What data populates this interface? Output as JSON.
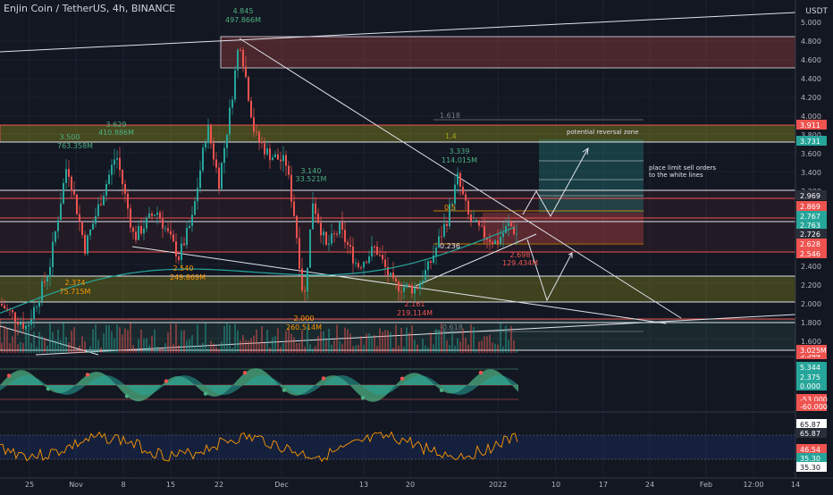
{
  "header": {
    "title": "Enjin Coin / TetherUS, 4h, BINANCE",
    "currency": "USDT"
  },
  "colors": {
    "background": "#131722",
    "text": "#b2b5be",
    "up": "#26a69a",
    "down": "#ef5350",
    "white_line": "#e0e3eb",
    "resistance_zone": "#ef5350",
    "support_zone": "#a5a41a",
    "rsi_line": "#ff9800",
    "rsi_band": "#2962ff",
    "wave_green": "#4caf80",
    "dot_red": "#ef5350",
    "dot_green": "#4caf80"
  },
  "price_axis": {
    "ticks": [
      "5.000",
      "4.800",
      "4.600",
      "4.400",
      "4.200",
      "4.000",
      "3.800",
      "3.600",
      "3.400",
      "3.200",
      "2.400",
      "2.200",
      "2.000",
      "1.800",
      "1.600"
    ],
    "tags": [
      {
        "value": "5.344",
        "color": "#ef5350"
      },
      {
        "value": "3.911",
        "color": "#ef5350"
      },
      {
        "value": "3.731",
        "color": "#26a69a"
      },
      {
        "value": "2.969",
        "color": "#2a2e39"
      },
      {
        "value": "2.869",
        "color": "#ef5350"
      },
      {
        "value": "2.767",
        "color": "#26a69a"
      },
      {
        "value": "2.763",
        "color": "#26a69a"
      },
      {
        "value": "2.726",
        "color": "#2a2e39"
      },
      {
        "value": "2.628",
        "color": "#ef5350"
      },
      {
        "value": "2.546",
        "color": "#ef5350"
      },
      {
        "value": "3.025M",
        "color": "#ef5350"
      }
    ],
    "range": [
      1.45,
      5.15
    ]
  },
  "osc_axis": {
    "tags": [
      {
        "value": "5.344",
        "color": "#26a69a"
      },
      {
        "value": "2.375",
        "color": "#26a69a"
      },
      {
        "value": "0.000",
        "color": "#26a69a"
      },
      {
        "value": "-53.000",
        "color": "#ef5350"
      },
      {
        "value": "-60.000",
        "color": "#ef5350"
      }
    ]
  },
  "rsi_axis": {
    "tags": [
      {
        "value": "65.87",
        "color": "#ffffff"
      },
      {
        "value": "65.87",
        "color": "#2a2e39"
      },
      {
        "value": "46.54",
        "color": "#ef5350"
      },
      {
        "value": "35.30",
        "color": "#26a69a"
      },
      {
        "value": "35.30",
        "color": "#ffffff"
      }
    ]
  },
  "time_axis": {
    "ticks": [
      "25",
      "Nov",
      "8",
      "15",
      "22",
      "Dec",
      "13",
      "20",
      "2022",
      "10",
      "17",
      "24",
      "Feb",
      "12:00",
      "14"
    ]
  },
  "annotations": {
    "peak": {
      "price": "4.845",
      "volume": "497.866M"
    },
    "h1": {
      "price": "3.500",
      "volume": "763.358M"
    },
    "h2": {
      "price": "3.629",
      "volume": "410.886M"
    },
    "h3": {
      "price": "3.140",
      "volume": "33.521M"
    },
    "h4": {
      "price": "3.339",
      "volume": "114.015M"
    },
    "l1": {
      "price": "2.540",
      "volume": "249.869M"
    },
    "l2": {
      "price": "2.374",
      "volume": "75.715M"
    },
    "l3": {
      "price": "2.000",
      "volume": "260.514M"
    },
    "l4": {
      "price": "2.161",
      "volume": "219.114M"
    },
    "l5": {
      "price": "2.698",
      "volume": "129.434M"
    },
    "fib_1618": "1.618",
    "fib_14": "1.4",
    "fib_05": "0.5",
    "fib_0236": "0.236",
    "fib_neg0618": "-0.618",
    "reversal_zone": "potential reversal zone",
    "sell_note_1": "place limit sell orders",
    "sell_note_2": "to the white lines"
  }
}
